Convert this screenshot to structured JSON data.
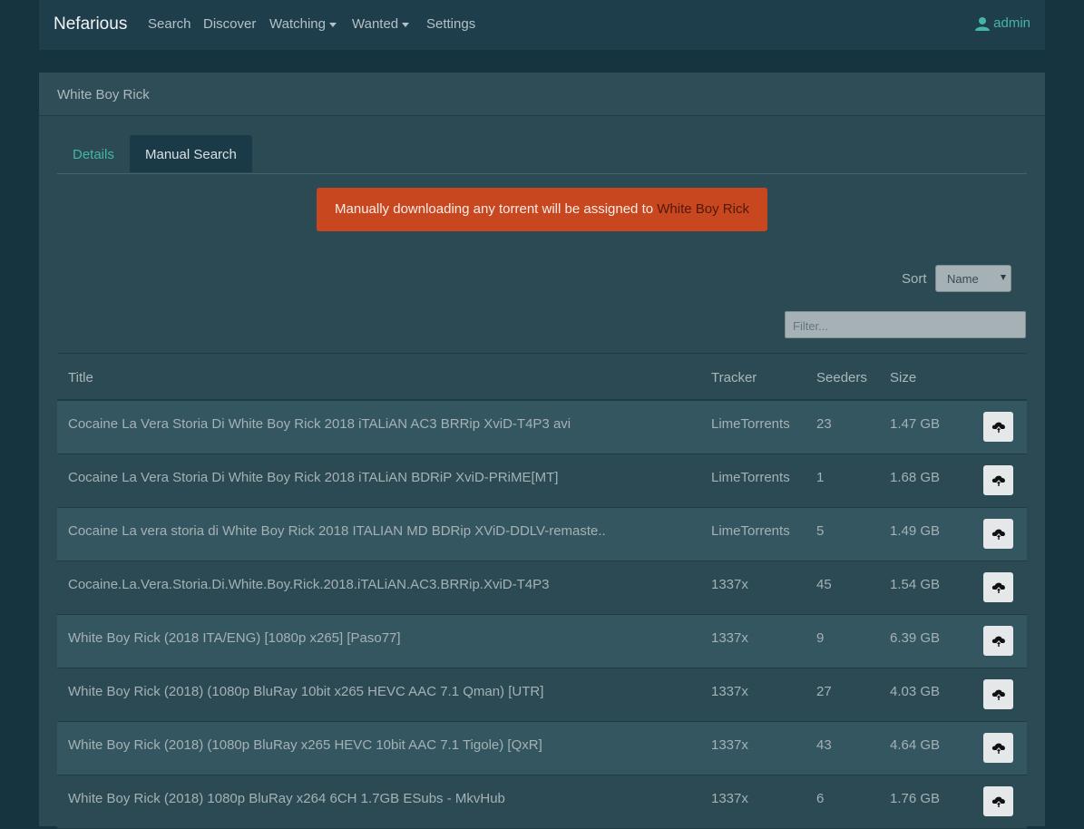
{
  "navbar": {
    "brand": "Nefarious",
    "items": [
      {
        "label": "Search"
      },
      {
        "label": "Discover"
      },
      {
        "label": "Watching"
      },
      {
        "label": "Wanted"
      },
      {
        "label": "Settings"
      }
    ],
    "user": "admin"
  },
  "card": {
    "header": "White Boy Rick",
    "tabs": [
      {
        "label": "Details"
      },
      {
        "label": "Manual Search"
      }
    ],
    "alert": {
      "text": "Manually downloading any torrent will be assigned to ",
      "highlight": "White Boy Rick"
    },
    "sort": {
      "label": "Sort",
      "value": "Name"
    },
    "filter": {
      "placeholder": "Filter..."
    },
    "table": {
      "headers": {
        "title": "Title",
        "tracker": "Tracker",
        "seeders": "Seeders",
        "size": "Size"
      },
      "rows": [
        {
          "title": "Cocaine La Vera Storia Di White Boy Rick 2018 iTALiAN AC3 BRRip XviD-T4P3 avi",
          "tracker": "LimeTorrents",
          "seeders": "23",
          "size": "1.47 GB"
        },
        {
          "title": "Cocaine La Vera Storia Di White Boy Rick 2018 iTALiAN BDRiP XviD-PRiME[MT]",
          "tracker": "LimeTorrents",
          "seeders": "1",
          "size": "1.68 GB"
        },
        {
          "title": "Cocaine La vera storia di White Boy Rick 2018 ITALIAN MD BDRip XViD-DDLV-remaste..",
          "tracker": "LimeTorrents",
          "seeders": "5",
          "size": "1.49 GB"
        },
        {
          "title": "Cocaine.La.Vera.Storia.Di.White.Boy.Rick.2018.iTALiAN.AC3.BRRip.XviD-T4P3",
          "tracker": "1337x",
          "seeders": "45",
          "size": "1.54 GB"
        },
        {
          "title": "White Boy Rick (2018 ITA/ENG) [1080p x265] [Paso77]",
          "tracker": "1337x",
          "seeders": "9",
          "size": "6.39 GB"
        },
        {
          "title": "White Boy Rick (2018) (1080p BluRay 10bit x265 HEVC AAC 7.1 Qman) [UTR]",
          "tracker": "1337x",
          "seeders": "27",
          "size": "4.03 GB"
        },
        {
          "title": "White Boy Rick (2018) (1080p BluRay x265 HEVC 10bit AAC 7.1 Tigole) [QxR]",
          "tracker": "1337x",
          "seeders": "43",
          "size": "4.64 GB"
        },
        {
          "title": "White Boy Rick (2018) 1080p BluRay x264 6CH 1.7GB ESubs - MkvHub",
          "tracker": "1337x",
          "seeders": "6",
          "size": "1.76 GB"
        }
      ]
    }
  }
}
